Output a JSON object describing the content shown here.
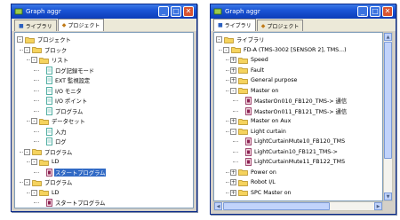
{
  "left_window": {
    "title": "Graph aggr",
    "tabs": [
      {
        "label": "ライブラリ"
      },
      {
        "label": "プロジェクト"
      }
    ],
    "rows": [
      {
        "label": "プロジェクト",
        "kind": "folder",
        "expander": "-",
        "selected": false
      },
      {
        "label": "ブロック",
        "kind": "folder",
        "expander": "-",
        "selected": false
      },
      {
        "label": "リスト",
        "kind": "folder",
        "expander": "-",
        "selected": false
      },
      {
        "label": "ログ記録モード",
        "kind": "doc",
        "expander": "",
        "selected": false
      },
      {
        "label": "EXT 監視設定",
        "kind": "doc",
        "expander": "",
        "selected": false
      },
      {
        "label": "I/O モニタ",
        "kind": "doc",
        "expander": "",
        "selected": false
      },
      {
        "label": "I/O ポイント",
        "kind": "doc",
        "expander": "",
        "selected": false
      },
      {
        "label": "プログラム",
        "kind": "doc",
        "expander": "",
        "selected": false
      },
      {
        "label": "データセット",
        "kind": "folder",
        "expander": "-",
        "selected": false
      },
      {
        "label": "入力",
        "kind": "doc",
        "expander": "",
        "selected": false
      },
      {
        "label": "ログ",
        "kind": "doc",
        "expander": "",
        "selected": false
      },
      {
        "label": "プログラム",
        "kind": "folder",
        "expander": "-",
        "selected": false
      },
      {
        "label": "LD",
        "kind": "folder",
        "expander": "-",
        "selected": false
      },
      {
        "label": "スタートプログラム",
        "kind": "prog",
        "expander": "",
        "selected": true
      },
      {
        "label": "プログラム",
        "kind": "folder",
        "expander": "-",
        "selected": false
      },
      {
        "label": "LD",
        "kind": "folder",
        "expander": "-",
        "selected": false
      },
      {
        "label": "スタートプログラム",
        "kind": "prog",
        "expander": "",
        "selected": false
      }
    ]
  },
  "right_window": {
    "title": "Graph aggr",
    "tabs": [
      {
        "label": "ライブラリ"
      },
      {
        "label": "プロジェクト"
      }
    ],
    "rows": [
      {
        "label": "ライブラリ",
        "kind": "folder",
        "expander": "-",
        "selected": false
      },
      {
        "label": "FD-A (TMS-3002 [SENSOR 2], TMS...)",
        "kind": "folder",
        "expander": "-",
        "selected": false
      },
      {
        "label": "Speed",
        "kind": "folder",
        "expander": "+",
        "selected": false
      },
      {
        "label": "Fault",
        "kind": "folder",
        "expander": "+",
        "selected": false
      },
      {
        "label": "General purpose",
        "kind": "folder",
        "expander": "+",
        "selected": false
      },
      {
        "label": "Master on",
        "kind": "folder",
        "expander": "-",
        "selected": false
      },
      {
        "label": "MasterOn010_FB120_TMS-> 通信",
        "kind": "prog",
        "expander": "",
        "selected": false
      },
      {
        "label": "MasterOn011_FB121_TMS-> 通信",
        "kind": "prog",
        "expander": "",
        "selected": false
      },
      {
        "label": "Master on Aux",
        "kind": "folder",
        "expander": "+",
        "selected": false
      },
      {
        "label": "Light curtain",
        "kind": "folder",
        "expander": "-",
        "selected": false
      },
      {
        "label": "LightCurtainMute10_FB120_TMS",
        "kind": "prog",
        "expander": "",
        "selected": false
      },
      {
        "label": "LightCurtain10_FB121_TMS->",
        "kind": "prog",
        "expander": "",
        "selected": false
      },
      {
        "label": "LightCurtainMute11_FB122_TMS",
        "kind": "prog",
        "expander": "",
        "selected": false
      },
      {
        "label": "Power on",
        "kind": "folder",
        "expander": "+",
        "selected": false
      },
      {
        "label": "Robot I/L",
        "kind": "folder",
        "expander": "+",
        "selected": false
      },
      {
        "label": "SPC Master on",
        "kind": "folder",
        "expander": "+",
        "selected": false
      }
    ]
  }
}
